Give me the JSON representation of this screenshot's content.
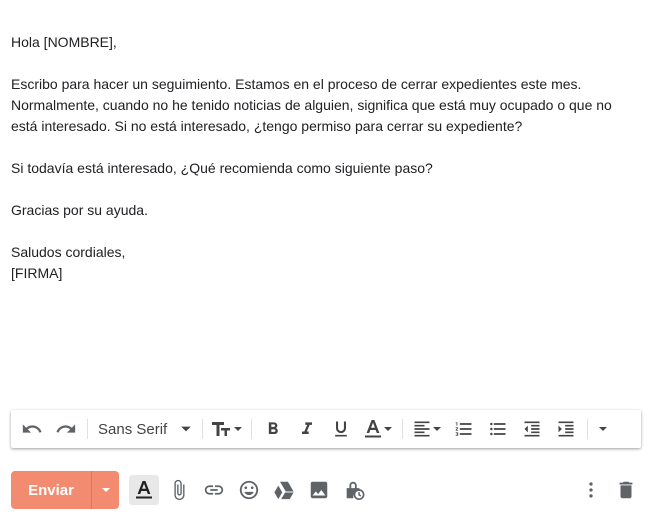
{
  "email": {
    "greeting": "Hola [NOMBRE],",
    "paragraph1_line1": "Escribo para hacer un seguimiento. Estamos en el proceso de cerrar expedientes este mes.",
    "paragraph1_line2": "Normalmente, cuando no he tenido noticias de alguien, significa que está muy ocupado o que no",
    "paragraph1_line3": "está interesado. Si no está interesado, ¿tengo permiso para cerrar su expediente?",
    "paragraph2": "Si todavía está interesado, ¿Qué recomienda como siguiente paso?",
    "paragraph3": "Gracias por su ayuda.",
    "closing": "Saludos cordiales,",
    "signature": "[FIRMA]"
  },
  "toolbar": {
    "font_name": "Sans Serif",
    "icons": [
      "undo-icon",
      "redo-icon",
      "font-size-icon",
      "bold-icon",
      "italic-icon",
      "underline-icon",
      "text-color-icon",
      "align-icon",
      "numbered-list-icon",
      "bulleted-list-icon",
      "indent-less-icon",
      "indent-more-icon",
      "more-formatting-icon"
    ]
  },
  "bottom_bar": {
    "send_label": "Enviar",
    "icons": [
      "formatting-options-icon",
      "attach-icon",
      "link-icon",
      "emoji-icon",
      "drive-icon",
      "photo-icon",
      "confidential-mode-icon",
      "more-options-icon",
      "discard-icon"
    ]
  },
  "colors": {
    "send_button": "#f28b6f",
    "text": "#202124",
    "icon": "#5f6368"
  }
}
